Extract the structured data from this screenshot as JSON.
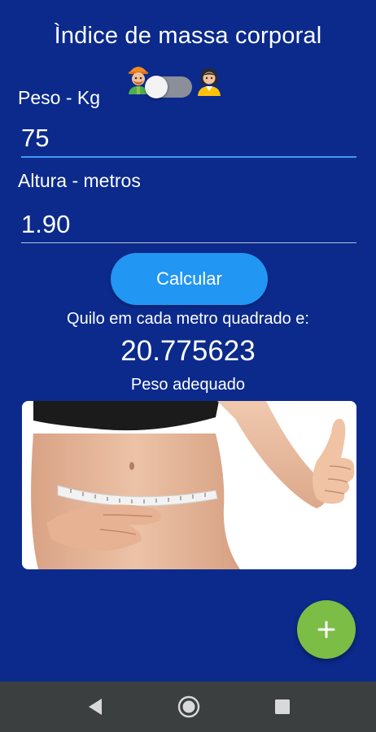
{
  "app": {
    "title": "Ìndice de massa corporal"
  },
  "gender_toggle": {
    "left_icon": "male-avatar-icon",
    "right_icon": "female-avatar-icon",
    "state": "off"
  },
  "form": {
    "weight_label": "Peso - Kg",
    "weight_value": "75",
    "height_label": "Altura - metros",
    "height_value": "1.90"
  },
  "actions": {
    "calculate_label": "Calcular",
    "fab_icon": "plus-icon"
  },
  "result": {
    "caption": "Quilo em cada metro quadrado e:",
    "value": "20.775623",
    "status": "Peso adequado"
  },
  "nav": {
    "back_icon": "back-triangle-icon",
    "home_icon": "home-circle-icon",
    "recent_icon": "recent-apps-square-icon"
  },
  "colors": {
    "background": "#0b2a8c",
    "accent": "#2196f3",
    "fab": "#7cbd45",
    "navbar": "#3b3f40"
  }
}
